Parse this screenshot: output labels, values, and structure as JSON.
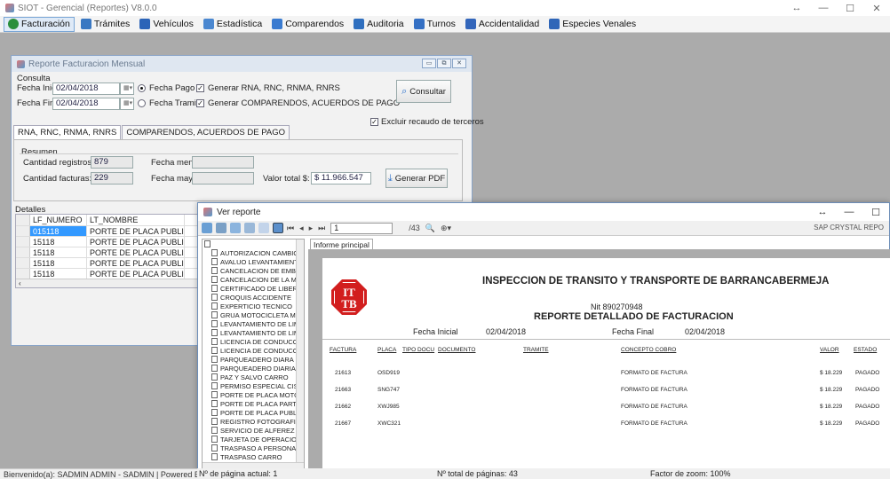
{
  "app": {
    "title": "SIOT - Gerencial (Reportes) V8.0.0",
    "window_controls": [
      "↔",
      "—",
      "☐",
      "✕"
    ]
  },
  "menu": [
    {
      "label": "Facturación",
      "icon": "dollar-icon",
      "color": "#2a8f3c"
    },
    {
      "label": "Trámites",
      "icon": "checklist-icon",
      "color": "#3a78c2"
    },
    {
      "label": "Vehículos",
      "icon": "car-icon",
      "color": "#2c64b8"
    },
    {
      "label": "Estadística",
      "icon": "chart-icon",
      "color": "#4a87d0"
    },
    {
      "label": "Comparendos",
      "icon": "document-icon",
      "color": "#3a7bd0"
    },
    {
      "label": "Auditoria",
      "icon": "audit-icon",
      "color": "#2f6fbf"
    },
    {
      "label": "Turnos",
      "icon": "turn-icon",
      "color": "#3470c4"
    },
    {
      "label": "Accidentalidad",
      "icon": "accident-icon",
      "color": "#3366bb"
    },
    {
      "label": "Especies Venales",
      "icon": "stamp-icon",
      "color": "#2f66b8"
    }
  ],
  "status_bar": {
    "left": "Bienvenido(a): SADMIN ADMIN - SADMIN | Powered By: Service"
  },
  "reporte_facturacion": {
    "title": "Reporte Facturacion Mensual",
    "ctrls": [
      "▭",
      "⧉",
      "✕"
    ],
    "consulta_label": "Consulta",
    "fecha_inicio_label": "Fecha Inicio",
    "fecha_inicio_value": "02/04/2018",
    "fecha_fin_label": "Fecha Fin",
    "fecha_fin_value": "02/04/2018",
    "radio_pago": "Fecha Pago",
    "radio_tramite": "Fecha Tramite",
    "check_rna": "Generar RNA, RNC, RNMA, RNRS",
    "check_comparendos": "Generar COMPARENDOS, ACUERDOS DE PAGO",
    "check_excluir": "Excluir recaudo de terceros",
    "consultar_button": "Consultar",
    "tabs": [
      "RNA, RNC, RNMA, RNRS",
      "COMPARENDOS, ACUERDOS DE PAGO"
    ],
    "resumen_label": "Resumen",
    "cantidad_registros_label": "Cantidad registros:",
    "cantidad_registros_value": "879",
    "cantidad_facturas_label": "Cantidad facturas:",
    "cantidad_facturas_value": "229",
    "fecha_menor_label": "Fecha menor:",
    "fecha_mayor_label": "Fecha mayor:",
    "valor_total_label": "Valor total $:",
    "valor_total_value": "$ 11.966.547",
    "generar_pdf_button": "Generar PDF",
    "detalles_label": "Detalles",
    "grid_headers": [
      "LF_NUMERO",
      "LT_NOMBRE"
    ],
    "grid_rows": [
      [
        "015118",
        "PORTE DE PLACA PUBLICO"
      ],
      [
        "15118",
        "PORTE DE PLACA PUBLICO"
      ],
      [
        "15118",
        "PORTE DE PLACA PUBLICO"
      ],
      [
        "15118",
        "PORTE DE PLACA PUBLICO"
      ],
      [
        "15118",
        "PORTE DE PLACA PUBLICO"
      ]
    ]
  },
  "ver_reporte": {
    "title": "Ver reporte",
    "ctrls": [
      "↔",
      "—",
      "☐"
    ],
    "page_value": "1",
    "page_total": "/43",
    "brand": "SAP CRYSTAL REPO",
    "tab_label": "Informe principal",
    "tree_items": [
      "AUTORIZACION CAMBIO DE",
      "AVALUO LEVANTAMIENTO DE",
      "CANCELACION DE EMBARGO",
      "CANCELACION DE LA MATRI",
      "CERTIFICADO DE LIBERTAD",
      "CROQUIS ACCIDENTE",
      "EXPERTICIO TECNICO",
      "GRUA MOTOCICLETA MOTOT",
      "LEVANTAMIENTO DE LIMITA(",
      "LEVANTAMIENTO DE LIMITA(",
      "LICENCIA DE CONDUCCION",
      "LICENCIA DE CONDUCCION",
      "PARQUEADERO DIARA MOTO",
      "PARQUEADERO DIARIA VEH",
      "PAZ Y SALVO CARRO",
      "PERMISO ESPECIAL CISTERN",
      "PORTE DE PLACA MOTOCICL",
      "PORTE DE PLACA PARTICULA",
      "PORTE DE PLACA PUBLICO",
      "REGISTRO FOTOGRAFICO",
      "SERVICIO DE ALFEREZ HORA",
      "TARJETA DE OPERACION TA",
      "TRASPASO A PERSONA INDE",
      "TRASPASO CARRO"
    ],
    "report": {
      "logo_text": "ITTB",
      "header": "INSPECCION DE TRANSITO Y TRANSPORTE DE BARRANCABERMEJA",
      "nit": "Nit  890270948",
      "subtitle": "REPORTE DETALLADO DE FACTURACION",
      "fecha_inicial_label": "Fecha Inicial",
      "fecha_inicial_value": "02/04/2018",
      "fecha_final_label": "Fecha Final",
      "fecha_final_value": "02/04/2018",
      "columns": [
        "FACTURA",
        "PLACA",
        "TIPO DOCU",
        "DOCUMENTO",
        "TRAMITE",
        "CONCEPTO COBRO",
        "VALOR",
        "ESTADO"
      ],
      "rows": [
        [
          "21613",
          "OSD919",
          "FORMATO DE FACTURA",
          "$ 18.229",
          "PAGADO"
        ],
        [
          "21663",
          "SNG747",
          "FORMATO DE FACTURA",
          "$ 18.229",
          "PAGADO"
        ],
        [
          "21662",
          "XWJ985",
          "FORMATO DE FACTURA",
          "$ 18.229",
          "PAGADO"
        ],
        [
          "21667",
          "XWC321",
          "FORMATO DE FACTURA",
          "$ 18.229",
          "PAGADO"
        ]
      ]
    },
    "status_page": "Nº de página actual: 1",
    "status_total": "Nº total de páginas: 43",
    "status_zoom": "Factor de zoom: 100%"
  }
}
